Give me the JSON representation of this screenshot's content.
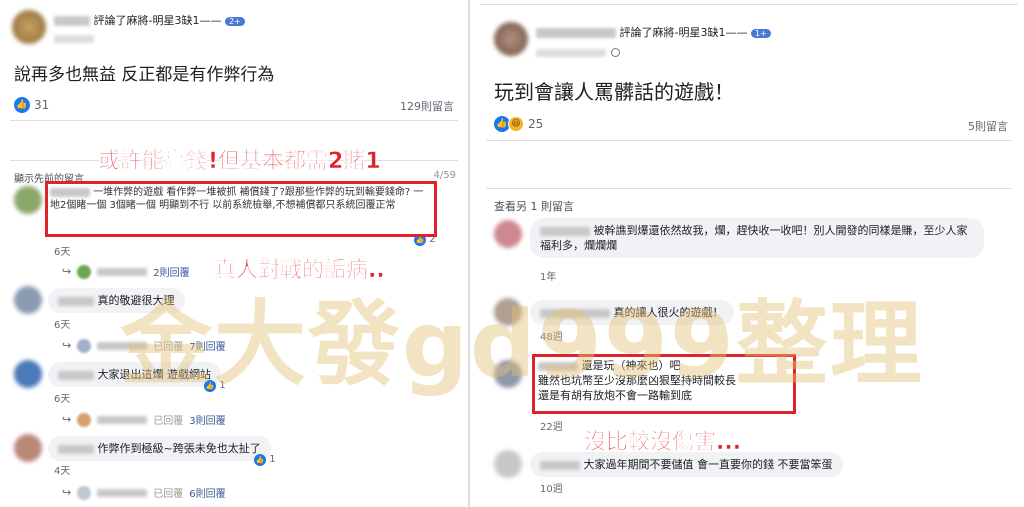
{
  "left_post": {
    "header_suffix": "評論了麻將-明星3缺1——",
    "header_badge": "2+",
    "body": "說再多也無益 反正都是有作弊行為",
    "reaction_count": "31",
    "comment_count": "129則留言",
    "prev_comments": "顯示先前的留言",
    "pager": "4/59",
    "comments": [
      {
        "text": "一堆作弊的遊戲 看作弊一堆被抓 補償錢了?跟那些作弊的玩到輸要錢命? 一地2個睹一個 3個睹一個 明顯到不行 以前系統檢舉,不想補償都只系統回覆正常",
        "time": "6天",
        "likes": "2",
        "replies": "2則回覆"
      },
      {
        "text": "真的敬避很大理",
        "time": "6天",
        "replies": "7則回覆"
      },
      {
        "text": "大家退出這爛 遊戲網站",
        "time": "6天",
        "likes": "1",
        "replies": "3則回覆"
      },
      {
        "text": "作弊作到極級~跨張未免也太扯了",
        "time": "4天",
        "likes": "1",
        "replies": "6則回覆"
      }
    ],
    "replies_prefix": "已回覆"
  },
  "right_post": {
    "header_suffix": "評論了麻將-明星3缺1——",
    "header_badge": "1+",
    "body": "玩到會讓人罵髒話的遊戲！",
    "reaction_count": "25",
    "comment_count": "5則留言",
    "more_comments": "查看另 1 則留言",
    "comments": [
      {
        "text": "被幹譙到爆還依然故我，爛，趕快收一收吧！別人開發的同樣是賺，至少人家福利多，爛爛爛",
        "time": "1年"
      },
      {
        "text": "真的讓人很火的遊戲！",
        "time": "48週"
      },
      {
        "line1": "還是玩（神來也）吧",
        "line2": "雖然也坑幣至少沒那麼凶狠堅持時間較長",
        "line3": "還是有胡有放炮不會一路輸到底",
        "time": "22週"
      },
      {
        "text": "大家過年期間不要儲值 會一直要你的錢 不要當笨蛋",
        "time": "10週"
      }
    ]
  },
  "annotations": {
    "a1": "或許能贏錢!但基本都需2賭1",
    "a2": "真人對戰的詬病..",
    "a3": "沒比較沒傷害...",
    "watermark": "金大發gd999整理"
  },
  "colors": {
    "annotation_red": "#e0232a",
    "facebook_blue": "#1877f2"
  }
}
